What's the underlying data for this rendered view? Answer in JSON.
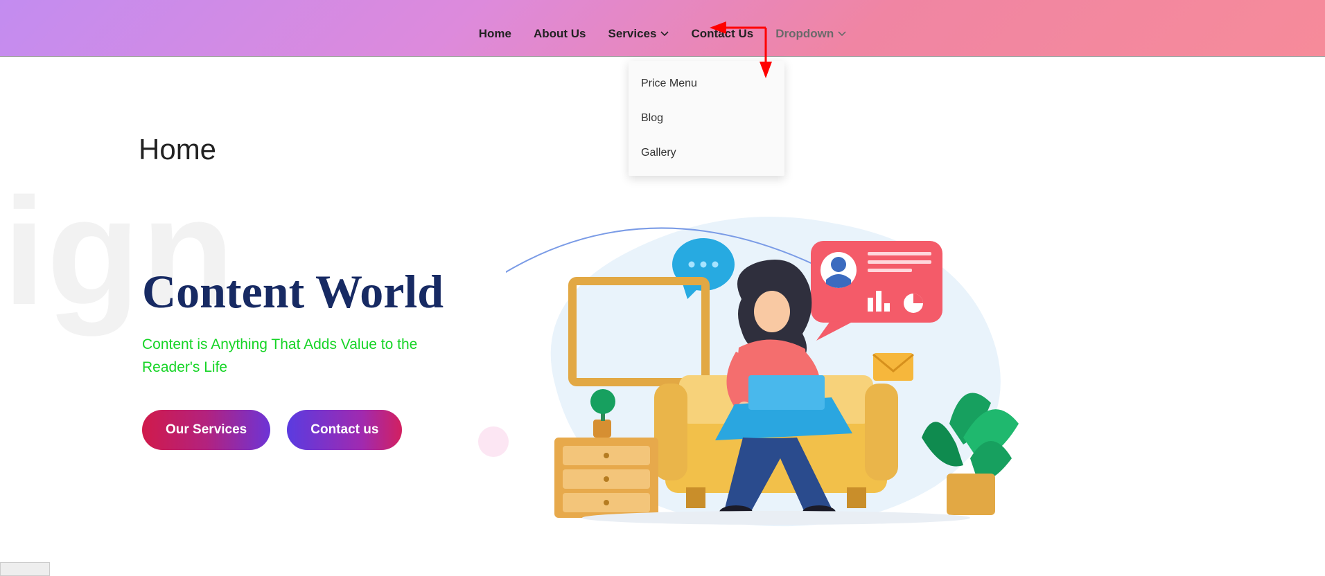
{
  "nav": {
    "items": [
      {
        "label": "Home"
      },
      {
        "label": "About Us"
      },
      {
        "label": "Services",
        "has_chevron": true
      },
      {
        "label": "Contact Us"
      },
      {
        "label": "Dropdown",
        "has_chevron": true,
        "muted": true,
        "open": true
      }
    ]
  },
  "dropdown": {
    "items": [
      {
        "label": "Price Menu"
      },
      {
        "label": "Blog"
      },
      {
        "label": "Gallery"
      }
    ]
  },
  "page": {
    "section_title": "Home",
    "bg_word": "sign",
    "hero_title": "Content World",
    "hero_sub": "Content is Anything That Adds Value to the Reader's Life"
  },
  "cta": {
    "primary": "Our Services",
    "secondary": "Contact us"
  },
  "colors": {
    "nav_gradient_from": "#c38cf0",
    "nav_gradient_to": "#f68b9a",
    "title_color": "#172a63",
    "sub_color": "#16d426",
    "btn_primary_from": "#d01a4b",
    "btn_primary_to": "#6d34d6",
    "btn_secondary_from": "#5a3be0",
    "btn_secondary_to": "#d22060",
    "annotation_arrow": "#ff0000"
  }
}
